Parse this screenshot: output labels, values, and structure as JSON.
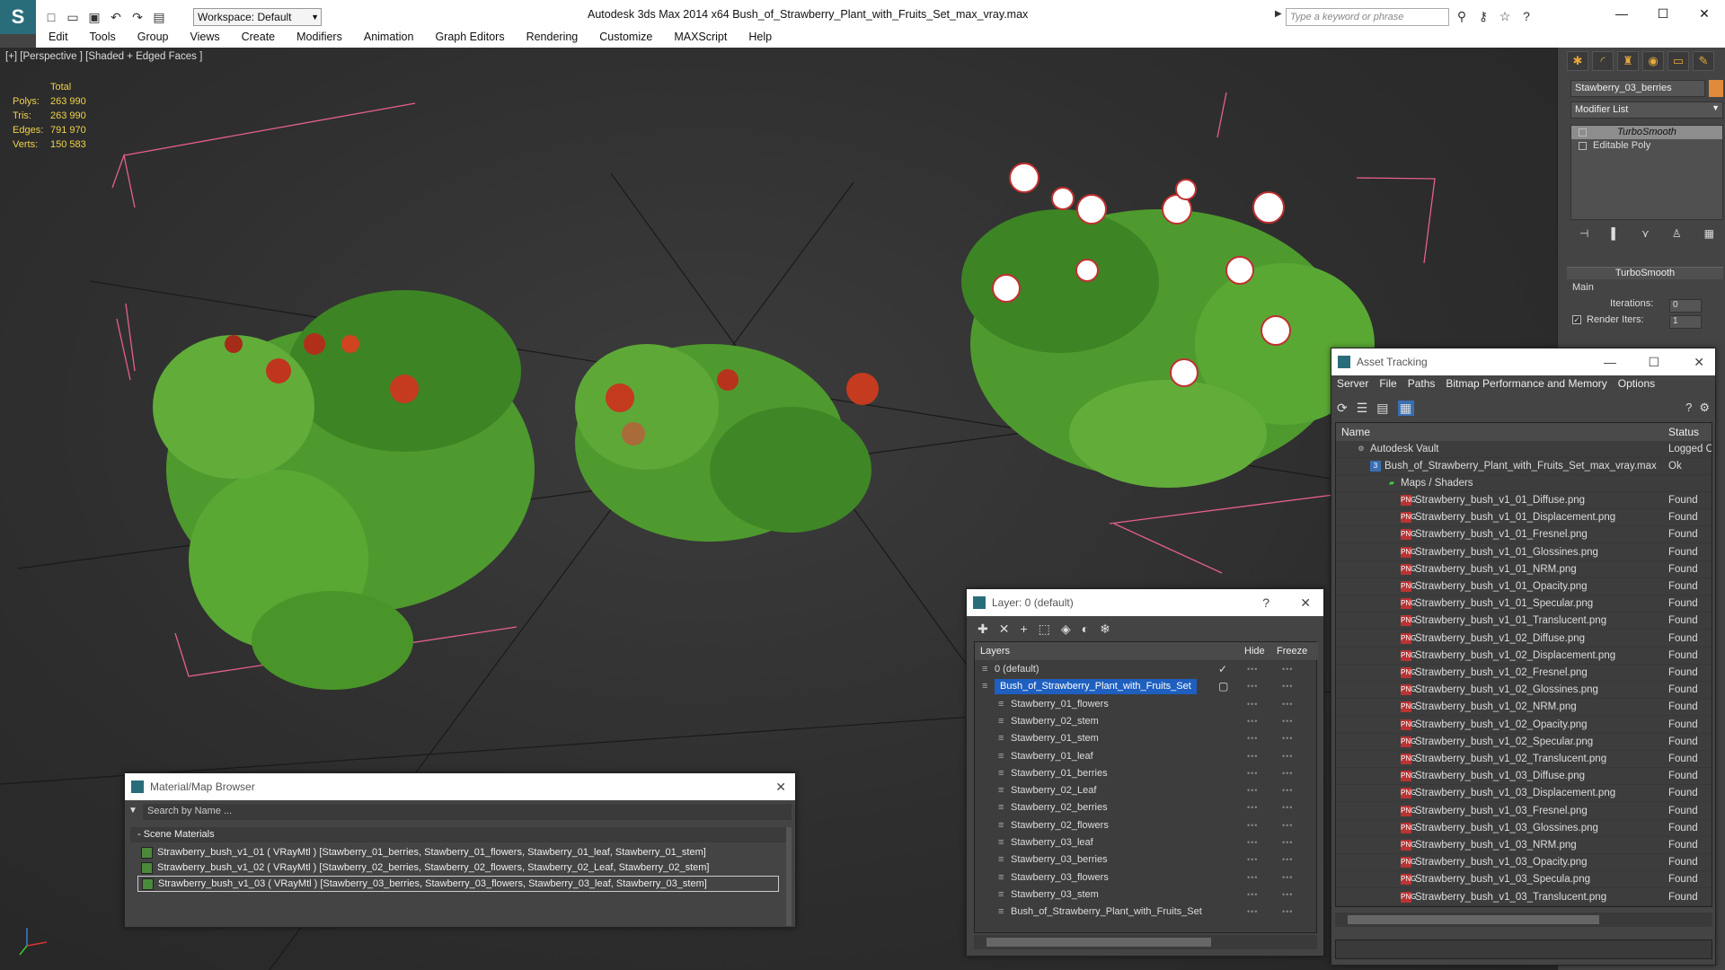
{
  "app": {
    "logo": "S",
    "title": "Autodesk 3ds Max  2014 x64     Bush_of_Strawberry_Plant_with_Fruits_Set_max_vray.max",
    "workspace": "Workspace: Default",
    "search_placeholder": "Type a keyword or phrase"
  },
  "menu": [
    "Edit",
    "Tools",
    "Group",
    "Views",
    "Create",
    "Modifiers",
    "Animation",
    "Graph Editors",
    "Rendering",
    "Customize",
    "MAXScript",
    "Help"
  ],
  "viewport": {
    "label": "[+] [Perspective ] [Shaded + Edged Faces ]",
    "stats": {
      "header": "Total",
      "rows": [
        {
          "label": "Polys:",
          "value": "263 990"
        },
        {
          "label": "Tris:",
          "value": "263 990"
        },
        {
          "label": "Edges:",
          "value": "791 970"
        },
        {
          "label": "Verts:",
          "value": "150 583"
        }
      ]
    }
  },
  "command_panel": {
    "object_name": "Stawberry_03_berries",
    "object_color": "#e08a3c",
    "modifier_list": "Modifier List",
    "stack": [
      "TurboSmooth",
      "Editable Poly"
    ],
    "rollout_title": "TurboSmooth",
    "group_label": "Main",
    "iterations_label": "Iterations:",
    "iterations_value": "0",
    "render_iters_label": "Render Iters:",
    "render_iters_value": "1"
  },
  "material_browser": {
    "title": "Material/Map Browser",
    "search": "Search by Name ...",
    "category": "- Scene Materials",
    "rows": [
      "Strawberry_bush_v1_01  ( VRayMtl )  [Stawberry_01_berries, Stawberry_01_flowers, Stawberry_01_leaf, Stawberry_01_stem]",
      "Strawberry_bush_v1_02  ( VRayMtl )  [Stawberry_02_berries, Stawberry_02_flowers, Stawberry_02_Leaf, Stawberry_02_stem]",
      "Strawberry_bush_v1_03  ( VRayMtl )  [Stawberry_03_berries, Stawberry_03_flowers, Stawberry_03_leaf, Stawberry_03_stem]"
    ]
  },
  "layer_manager": {
    "title": "Layer: 0 (default)",
    "help": "?",
    "columns": {
      "layers": "Layers",
      "hide": "Hide",
      "freeze": "Freeze"
    },
    "rows": [
      "0 (default)",
      "Bush_of_Strawberry_Plant_with_Fruits_Set",
      "Stawberry_01_flowers",
      "Stawberry_02_stem",
      "Stawberry_01_stem",
      "Stawberry_01_leaf",
      "Stawberry_01_berries",
      "Stawberry_02_Leaf",
      "Stawberry_02_berries",
      "Stawberry_02_flowers",
      "Stawberry_03_leaf",
      "Stawberry_03_berries",
      "Stawberry_03_flowers",
      "Stawberry_03_stem",
      "Bush_of_Strawberry_Plant_with_Fruits_Set"
    ]
  },
  "asset_tracking": {
    "title": "Asset Tracking",
    "menu": [
      "Server",
      "File",
      "Paths",
      "Bitmap Performance and Memory",
      "Options"
    ],
    "columns": {
      "name": "Name",
      "status": "Status"
    },
    "vault": {
      "name": "Autodesk Vault",
      "status": "Logged O"
    },
    "file": {
      "name": "Bush_of_Strawberry_Plant_with_Fruits_Set_max_vray.max",
      "status": "Ok"
    },
    "maps_folder": "Maps / Shaders",
    "maps": [
      {
        "name": "Strawberry_bush_v1_01_Diffuse.png",
        "status": "Found"
      },
      {
        "name": "Strawberry_bush_v1_01_Displacement.png",
        "status": "Found"
      },
      {
        "name": "Strawberry_bush_v1_01_Fresnel.png",
        "status": "Found"
      },
      {
        "name": "Strawberry_bush_v1_01_Glossines.png",
        "status": "Found"
      },
      {
        "name": "Strawberry_bush_v1_01_NRM.png",
        "status": "Found"
      },
      {
        "name": "Strawberry_bush_v1_01_Opacity.png",
        "status": "Found"
      },
      {
        "name": "Strawberry_bush_v1_01_Specular.png",
        "status": "Found"
      },
      {
        "name": "Strawberry_bush_v1_01_Translucent.png",
        "status": "Found"
      },
      {
        "name": "Strawberry_bush_v1_02_Diffuse.png",
        "status": "Found"
      },
      {
        "name": "Strawberry_bush_v1_02_Displacement.png",
        "status": "Found"
      },
      {
        "name": "Strawberry_bush_v1_02_Fresnel.png",
        "status": "Found"
      },
      {
        "name": "Strawberry_bush_v1_02_Glossines.png",
        "status": "Found"
      },
      {
        "name": "Strawberry_bush_v1_02_NRM.png",
        "status": "Found"
      },
      {
        "name": "Strawberry_bush_v1_02_Opacity.png",
        "status": "Found"
      },
      {
        "name": "Strawberry_bush_v1_02_Specular.png",
        "status": "Found"
      },
      {
        "name": "Strawberry_bush_v1_02_Translucent.png",
        "status": "Found"
      },
      {
        "name": "Strawberry_bush_v1_03_Diffuse.png",
        "status": "Found"
      },
      {
        "name": "Strawberry_bush_v1_03_Displacement.png",
        "status": "Found"
      },
      {
        "name": "Strawberry_bush_v1_03_Fresnel.png",
        "status": "Found"
      },
      {
        "name": "Strawberry_bush_v1_03_Glossines.png",
        "status": "Found"
      },
      {
        "name": "Strawberry_bush_v1_03_NRM.png",
        "status": "Found"
      },
      {
        "name": "Strawberry_bush_v1_03_Opacity.png",
        "status": "Found"
      },
      {
        "name": "Strawberry_bush_v1_03_Specula.png",
        "status": "Found"
      },
      {
        "name": "Strawberry_bush_v1_03_Translucent.png",
        "status": "Found"
      }
    ]
  }
}
